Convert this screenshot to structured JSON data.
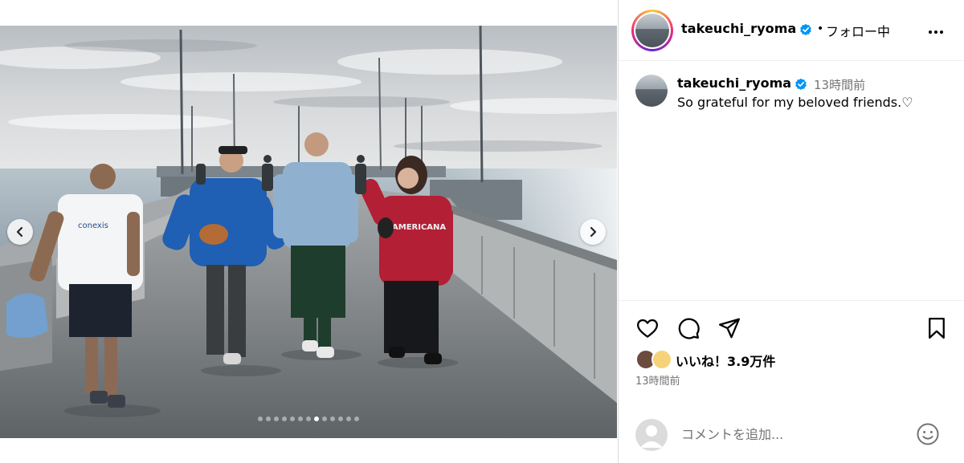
{
  "post": {
    "username": "takeuchi_ryoma",
    "follow_separator": "•",
    "follow_status": "フォロー中",
    "more_icon": "more-horizontal-icon",
    "verified_color": "#0095f6"
  },
  "caption": {
    "username": "takeuchi_ryoma",
    "time": "13時間前",
    "text": "So grateful for my beloved friends.♡"
  },
  "carousel": {
    "total_slides": 13,
    "active_slide": 8,
    "prev_icon": "chevron-left-icon",
    "next_icon": "chevron-right-icon"
  },
  "photo": {
    "shirt_logo": "conexis",
    "sweatshirt_text": "AMERICANA"
  },
  "actions": {
    "icons": [
      "heart-icon",
      "comment-icon",
      "share-icon",
      "bookmark-icon"
    ]
  },
  "likes": {
    "text": "いいね！3.9万件"
  },
  "timestamp": "13時間前",
  "comment": {
    "placeholder": "コメントを追加...",
    "emoji_icon": "smiley-icon"
  }
}
